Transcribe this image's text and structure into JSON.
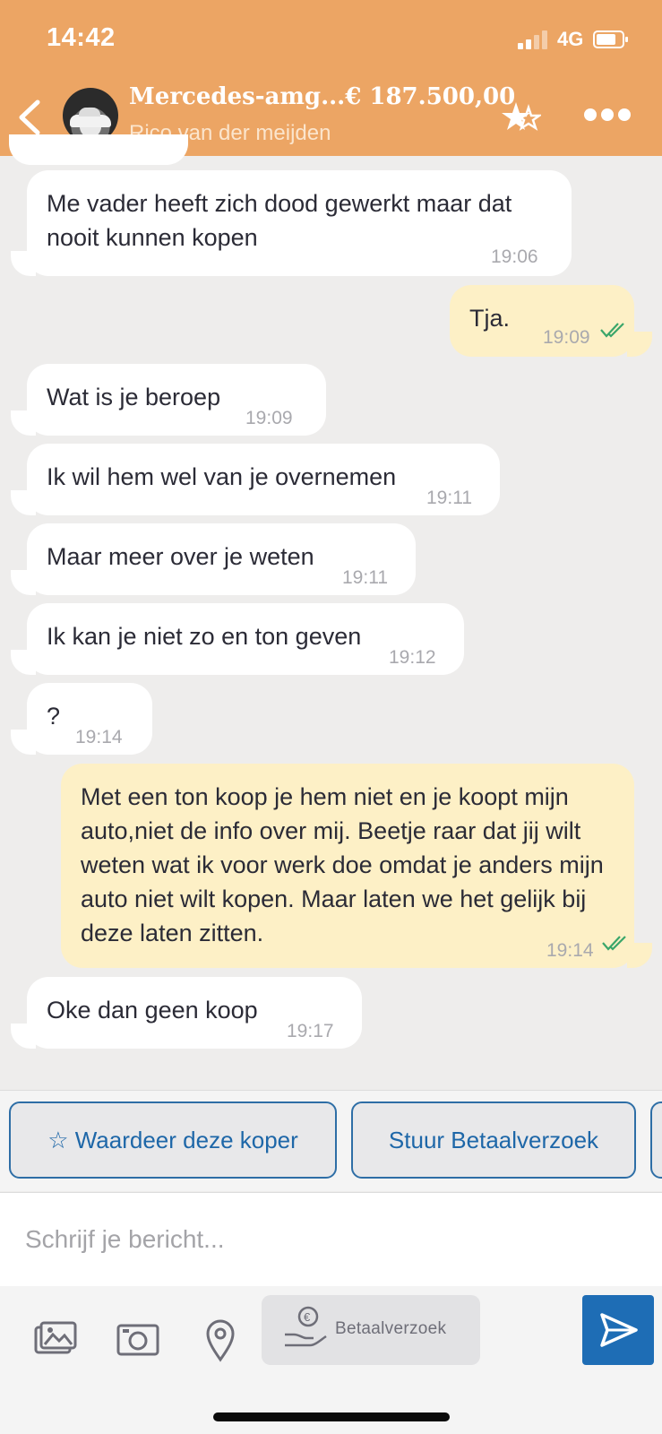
{
  "status": {
    "time": "14:42",
    "network": "4G"
  },
  "header": {
    "title": "Mercedes-amg...€ 187.500,00",
    "subtitle": "Rico van der meijden"
  },
  "messages": [
    {
      "dir": "in",
      "text": "Me vader heeft zich dood gewerkt maar dat nooit kunnen kopen",
      "time": "19:06"
    },
    {
      "dir": "out",
      "text": "Tja.",
      "time": "19:09",
      "read": true
    },
    {
      "dir": "in",
      "text": "Wat is je beroep",
      "time": "19:09"
    },
    {
      "dir": "in",
      "text": "Ik wil hem wel van je overnemen",
      "time": "19:11"
    },
    {
      "dir": "in",
      "text": "Maar meer over je weten",
      "time": "19:11"
    },
    {
      "dir": "in",
      "text": "Ik kan je niet zo en ton geven",
      "time": "19:12"
    },
    {
      "dir": "in",
      "text": "?",
      "time": "19:14"
    },
    {
      "dir": "out",
      "text": "Met een ton koop je hem niet en je koopt mijn auto,niet de info over mij. Beetje raar dat jij wilt weten wat ik voor werk doe omdat je anders mijn auto niet wilt kopen. Maar laten we het gelijk bij deze laten zitten.",
      "time": "19:14",
      "read": true
    },
    {
      "dir": "in",
      "text": "Oke dan geen koop",
      "time": "19:17"
    }
  ],
  "actions": {
    "rate_label": "☆ Waardeer deze koper",
    "pay_request_label": "Stuur Betaalverzoek"
  },
  "compose": {
    "placeholder": "Schrijf je bericht..."
  },
  "toolbar": {
    "pay_label": "Betaalverzoek"
  },
  "colors": {
    "header": "#eca564",
    "outgoing": "#fdf0c6",
    "incoming": "#ffffff",
    "accent": "#1e6db5",
    "check": "#3aa66a"
  }
}
